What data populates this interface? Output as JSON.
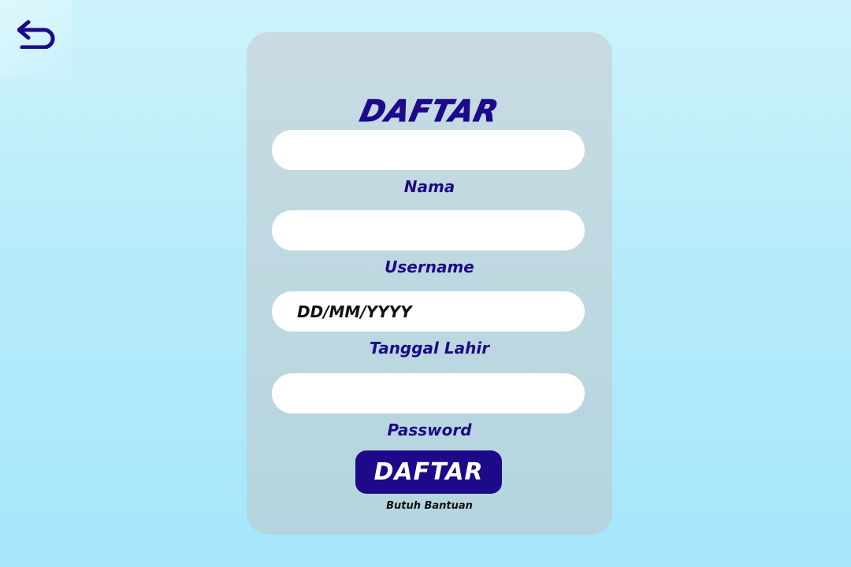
{
  "back": {
    "icon": "back-arrow-icon",
    "color": "#1c0a8a"
  },
  "form": {
    "title": "DAFTAR",
    "fields": [
      {
        "label": "Nama",
        "value": "",
        "placeholder": ""
      },
      {
        "label": "Username",
        "value": "",
        "placeholder": ""
      },
      {
        "label": "Tanggal Lahir",
        "value": "",
        "placeholder": "DD/MM/YYYY"
      },
      {
        "label": "Password",
        "value": "",
        "placeholder": ""
      }
    ],
    "submit_label": "DAFTAR",
    "help_link": "Butuh Bantuan"
  },
  "colors": {
    "accent": "#1c0a8a",
    "card": "#c1d9e0",
    "background": "#b6ebfa",
    "field": "#ffffff"
  }
}
